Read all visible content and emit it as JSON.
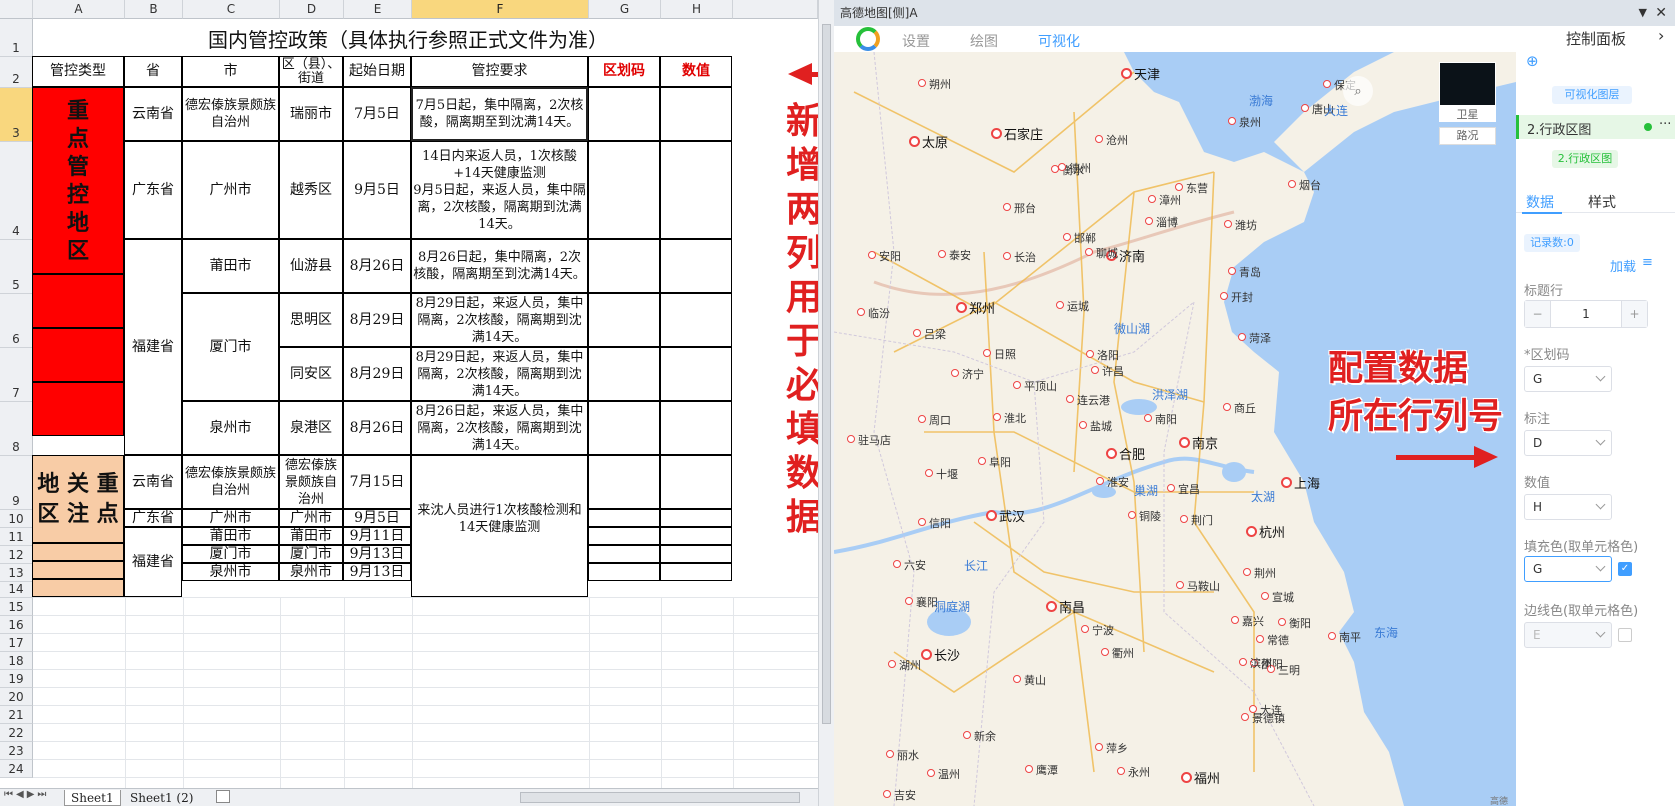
{
  "excel": {
    "columns": [
      "A",
      "B",
      "C",
      "D",
      "E",
      "F",
      "G",
      "H"
    ],
    "selected_column": "F",
    "rows": [
      "1",
      "2",
      "3",
      "4",
      "5",
      "6",
      "7",
      "8",
      "9",
      "10",
      "11",
      "12",
      "13",
      "14",
      "15",
      "16",
      "17",
      "18",
      "19",
      "20",
      "21",
      "22",
      "23",
      "24"
    ],
    "selected_row": "3",
    "title": "国内管控政策（具体执行参照正式文件为准）",
    "headers": {
      "type": "管控类型",
      "province": "省",
      "city": "市",
      "district": "区（县）、街道",
      "start": "起始日期",
      "req": "管控要求",
      "code": "区划码",
      "value": "数值"
    },
    "group1": "重\n点\n管\n控\n地\n区",
    "group2": "地 关 重\n区 注 点",
    "r3": {
      "province": "云南省",
      "city": "德宏傣族景颇族自治州",
      "district": "瑞丽市",
      "date": "7月5日",
      "req": "7月5日起，集中隔离，2次核酸，隔离期至到沈满14天。"
    },
    "r4": {
      "province": "广东省",
      "city": "广州市",
      "district": "越秀区",
      "date": "9月5日",
      "req": "14日内来返人员，1次核酸+14天健康监测\n9月5日起，来返人员，集中隔离，2次核酸，隔离期到沈满14天。"
    },
    "r5": {
      "city": "莆田市",
      "district": "仙游县",
      "date": "8月26日",
      "req": "8月26日起，集中隔离，2次核酸，隔离期至到沈满14天。"
    },
    "fujian": "福建省",
    "xiamen": "厦门市",
    "r6": {
      "district": "思明区",
      "date": "8月29日",
      "req": "8月29日起，来返人员，集中隔离，2次核酸，隔离期到沈满14天。"
    },
    "r7": {
      "district": "同安区",
      "date": "8月29日",
      "req": "8月29日起，来返人员，集中隔离，2次核酸，隔离期到沈满14天。"
    },
    "r8": {
      "city": "泉州市",
      "district": "泉港区",
      "date": "8月26日",
      "req": "8月26日起，来返人员，集中隔离，2次核酸，隔离期到沈满14天。"
    },
    "r9": {
      "province": "云南省",
      "city": "德宏傣族景颇族自治州",
      "district": "德宏傣族景颇族自治州",
      "date": "7月15日"
    },
    "req2": "来沈人员进行1次核酸检测和14天健康监测",
    "r10": {
      "province": "广东省",
      "city": "广州市",
      "district": "广州市",
      "date": "9月5日"
    },
    "r11": {
      "city": "莆田市",
      "district": "莆田市",
      "date": "9月11日"
    },
    "r12": {
      "province": "福建省",
      "city": "厦门市",
      "district": "厦门市",
      "date": "9月13日"
    },
    "r13": {
      "city": "泉州市",
      "district": "泉州市",
      "date": "9月13日"
    },
    "sheet_tabs": [
      "Sheet1",
      "Sheet1 (2)"
    ],
    "active_tab": "Sheet1"
  },
  "annotations": {
    "left_line1": "新增两列",
    "left_line2": "用于必填数据",
    "right_line1": "配置数据",
    "right_line2": "所在行列号"
  },
  "map_window": {
    "title": "高德地图[侧]A",
    "tabs": [
      "设置",
      "绘图",
      "可视化"
    ],
    "active_tab": "可视化",
    "panel_title": "控制面板",
    "layer_type_btn": "可视化图层",
    "layer_item": "2.行政区图",
    "layer_sub_btn": "2.行政区图",
    "data_tab": "数据",
    "style_tab": "样式",
    "record_count": "记录数:0",
    "load_btn": "加载",
    "title_row_label": "标题行",
    "title_row_value": "1",
    "minus": "−",
    "plus": "+",
    "region_code_label": "*区划码",
    "region_code_value": "G",
    "label_label": "标注",
    "label_value": "D",
    "value_label": "数值",
    "value_value": "H",
    "fill_label": "填充色(取单元格色)",
    "fill_value": "G",
    "border_label": "边线色(取单元格色)",
    "border_value": "E",
    "satellite": "卫星",
    "traffic": "路况",
    "logo_text": "高德",
    "colors": {
      "accent": "#409eff",
      "water": "#a9cdf5",
      "green": "#26c03a"
    }
  },
  "map_labels": {
    "big": [
      "天津",
      "太原",
      "石家庄",
      "济南",
      "郑州",
      "合肥",
      "南京",
      "武汉",
      "上海",
      "杭州",
      "南昌",
      "长沙",
      "福州"
    ],
    "small": [
      "朔州",
      "沧州",
      "衡水",
      "东营",
      "烟台",
      "淄博",
      "潍坊",
      "青岛",
      "德州",
      "邢台",
      "邯郸",
      "聊城",
      "泰安",
      "长治",
      "安阳",
      "临汾",
      "吕梁",
      "运城",
      "洛阳",
      "开封",
      "菏泽",
      "济宁",
      "日照",
      "连云港",
      "平顶山",
      "许昌",
      "商丘",
      "周口",
      "淮北",
      "盐城",
      "南阳",
      "驻马店",
      "阜阳",
      "淮安",
      "十堰",
      "信阳",
      "六安",
      "襄阳",
      "荆门",
      "宜昌",
      "荆州",
      "宣城",
      "马鞍山",
      "嘉兴",
      "宁波",
      "湖州",
      "黄山",
      "衢州",
      "景德镇",
      "常德",
      "新余",
      "鹰潭",
      "丽水",
      "温州",
      "萍乡",
      "吉安",
      "邵阳",
      "衡阳",
      "南平",
      "三明",
      "永州",
      "大连",
      "保定",
      "唐山",
      "泉州",
      "漳州",
      "滨州",
      "铜陵"
    ],
    "water": [
      "渤海",
      "大连",
      "微山湖",
      "洪泽湖",
      "太湖",
      "巢湖",
      "长江",
      "洞庭湖",
      "东海"
    ]
  }
}
